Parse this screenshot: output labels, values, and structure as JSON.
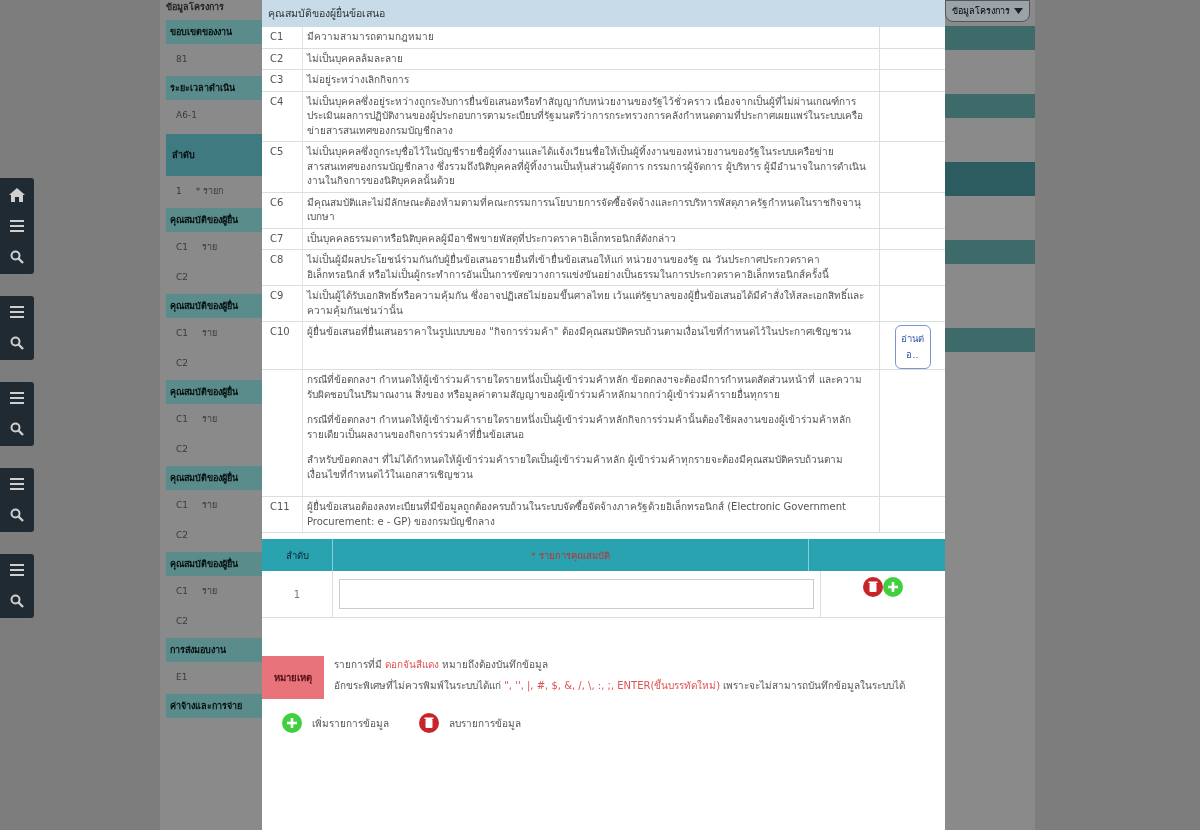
{
  "background_page": {
    "title": "ข้อมูลโครงการ",
    "dropdown": "ข้อมูลโครงการ",
    "sections": [
      {
        "kind": "header",
        "text": "ขอบเขตของงาน"
      },
      {
        "kind": "row",
        "cells": [
          "81"
        ]
      },
      {
        "kind": "header",
        "text": "ระยะเวลาดำเนิน"
      },
      {
        "kind": "row",
        "cells": [
          "A6-1"
        ]
      },
      {
        "kind": "table_header",
        "text": "ลำดับ"
      },
      {
        "kind": "row",
        "cells": [
          "1",
          "* รายก"
        ]
      },
      {
        "kind": "header",
        "text": "คุณสมบัติของผู้ยื่น"
      },
      {
        "kind": "row",
        "cells": [
          "C1",
          "ราย"
        ]
      },
      {
        "kind": "row",
        "cells": [
          "C2"
        ]
      },
      {
        "kind": "header",
        "text": "คุณสมบัติของผู้ยื่น"
      },
      {
        "kind": "row",
        "cells": [
          "C1",
          "ราย"
        ]
      },
      {
        "kind": "row",
        "cells": [
          "C2"
        ]
      },
      {
        "kind": "header",
        "text": "คุณสมบัติของผู้ยื่น"
      },
      {
        "kind": "row",
        "cells": [
          "C1",
          "ราย"
        ]
      },
      {
        "kind": "row",
        "cells": [
          "C2"
        ]
      },
      {
        "kind": "header",
        "text": "คุณสมบัติของผู้ยื่น"
      },
      {
        "kind": "row",
        "cells": [
          "C1",
          "ราย"
        ]
      },
      {
        "kind": "row",
        "cells": [
          "C2"
        ]
      },
      {
        "kind": "header",
        "text": "คุณสมบัติของผู้ยื่น"
      },
      {
        "kind": "row",
        "cells": [
          "C1",
          "ราย"
        ]
      },
      {
        "kind": "row",
        "cells": [
          "C2"
        ]
      },
      {
        "kind": "header",
        "text": "การส่งมอบงาน"
      },
      {
        "kind": "row",
        "cells": [
          "E1"
        ]
      },
      {
        "kind": "header",
        "text": "ค่าจ้างและการจ่าย"
      }
    ]
  },
  "dialog": {
    "title": "คุณสมบัติของผู้ยื่นข้อเสนอ",
    "qualifications": [
      {
        "code": "C1",
        "text": "มีความสามารถตามกฎหมาย"
      },
      {
        "code": "C2",
        "text": "ไม่เป็นบุคคลล้มละลาย"
      },
      {
        "code": "C3",
        "text": "ไม่อยู่ระหว่างเลิกกิจการ"
      },
      {
        "code": "C4",
        "text": "ไม่เป็นบุคคลซึ่งอยู่ระหว่างถูกระงับการยื่นข้อเสนอหรือทำสัญญากับหน่วยงานของรัฐไว้ชั่วคราว เนื่องจากเป็นผู้ที่ไม่ผ่านเกณฑ์การประเมินผลการปฏิบัติงานของผู้ประกอบการตามระเบียบที่รัฐมนตรีว่าการกระทรวงการคลังกำหนดตามที่ประกาศเผยแพร่ในระบบเครือข่ายสารสนเทศของกรมบัญชีกลาง"
      },
      {
        "code": "C5",
        "text": "ไม่เป็นบุคคลซึ่งถูกระบุชื่อไว้ในบัญชีรายชื่อผู้ทิ้งงานและได้แจ้งเวียนชื่อให้เป็นผู้ทิ้งงานของหน่วยงานของรัฐในระบบเครือข่ายสารสนเทศของกรมบัญชีกลาง ซึ่งรวมถึงนิติบุคคลที่ผู้ทิ้งงานเป็นหุ้นส่วนผู้จัดการ กรรมการผู้จัดการ ผู้บริหาร ผู้มีอำนาจในการดำเนินงานในกิจการของนิติบุคคลนั้นด้วย"
      },
      {
        "code": "C6",
        "text": "มีคุณสมบัติและไม่มีลักษณะต้องห้ามตามที่คณะกรรมการนโยบายการจัดซื้อจัดจ้างและการบริหารพัสดุภาครัฐกำหนดในราชกิจจานุเบกษา"
      },
      {
        "code": "C7",
        "text": "เป็นบุคคลธรรมดาหรือนิติบุคคลผู้มีอาชีพขายพัสดุที่ประกวดราคาอิเล็กทรอนิกส์ดังกล่าว"
      },
      {
        "code": "C8",
        "text": "ไม่เป็นผู้มีผลประโยชน์ร่วมกันกับผู้ยื่นข้อเสนอรายอื่นที่เข้ายื่นข้อเสนอให้แก่ หน่วยงานของรัฐ ณ วันประกาศประกวดราคาอิเล็กทรอนิกส์ หรือไม่เป็นผู้กระทำการอันเป็นการขัดขวางการแข่งขันอย่างเป็นธรรมในการประกวดราคาอิเล็กทรอนิกส์ครั้งนี้"
      },
      {
        "code": "C9",
        "text": "ไม่เป็นผู้ได้รับเอกสิทธิ์หรือความคุ้มกัน ซึ่งอาจปฏิเสธไม่ยอมขึ้นศาลไทย เว้นแต่รัฐบาลของผู้ยื่นข้อเสนอได้มีคำสั่งให้สละเอกสิทธิ์และความคุ้มกันเช่นว่านั้น"
      },
      {
        "code": "C10",
        "text": "ผู้ยื่นข้อเสนอที่ยื่นเสนอราคาในรูปแบบของ \"กิจการร่วมค้า\" ต้องมีคุณสมบัติครบถ้วนตามเงื่อนไขที่กำหนดไว้ในประกาศเชิญชวน",
        "button": "อ่านต่อ..",
        "details": [
          "กรณีที่ข้อตกลงฯ กำหนดให้ผู้เข้าร่วมค้ารายใดรายหนึ่งเป็นผู้เข้าร่วมค้าหลัก ข้อตกลงฯจะต้องมีการกำหนดสัดส่วนหน้าที่ และความรับผิดชอบในปริมาณงาน สิ่งของ หรือมูลค่าตามสัญญาของผู้เข้าร่วมค้าหลักมากกว่าผู้เข้าร่วมค้ารายอื่นทุกราย",
          "กรณีที่ข้อตกลงฯ กำหนดให้ผู้เข้าร่วมค้ารายใดรายหนึ่งเป็นผู้เข้าร่วมค้าหลักกิจการร่วมค้านั้นต้องใช้ผลงานของผู้เข้าร่วมค้าหลักรายเดียวเป็นผลงานของกิจการร่วมค้าที่ยื่นข้อเสนอ",
          "สำหรับข้อตกลงฯ ที่ไม่ได้กำหนดให้ผู้เข้าร่วมค้ารายใดเป็นผู้เข้าร่วมค้าหลัก ผู้เข้าร่วมค้าทุกรายจะต้องมีคุณสมบัติครบถ้วนตามเงื่อนไขที่กำหนดไว้ในเอกสารเชิญชวน"
        ]
      },
      {
        "code": "C11",
        "text": "ผู้ยื่นข้อเสนอต้องลงทะเบียนที่มีข้อมูลถูกต้องครบถ้วนในระบบจัดซื้อจัดจ้างภาครัฐด้วยอิเล็กทรอนิกส์ (Electronic Government Procurement: e - GP) ของกรมบัญชีกลาง"
      }
    ],
    "entry_table": {
      "columns": [
        "ลำดับ",
        "* รายการคุณสมบัติ"
      ],
      "rows": [
        {
          "index": "1"
        }
      ]
    },
    "note": {
      "badge": "หมายเหตุ",
      "lines": [
        [
          {
            "kind": "plain",
            "text": "รายการที่มี "
          },
          {
            "kind": "red",
            "text": "ดอกจันสีแดง"
          },
          {
            "kind": "plain",
            "text": " หมายถึงต้องบันทึกข้อมูล"
          }
        ],
        [
          {
            "kind": "plain",
            "text": "อักขระพิเศษที่ไม่ควรพิมพ์ในระบบได้แก่ "
          },
          {
            "kind": "red",
            "text": "\", '', |, #, $, &, /, \\, :, ;, ENTER(ขึ้นบรรทัดใหม่)"
          },
          {
            "kind": "plain",
            "text": " เพราะจะไม่สามารถบันทึกข้อมูลในระบบได้"
          }
        ]
      ]
    },
    "legend": [
      {
        "kind": "add",
        "text": "เพิ่มรายการข้อมูล"
      },
      {
        "kind": "delete",
        "text": "ลบรายการข้อมูล"
      }
    ]
  }
}
